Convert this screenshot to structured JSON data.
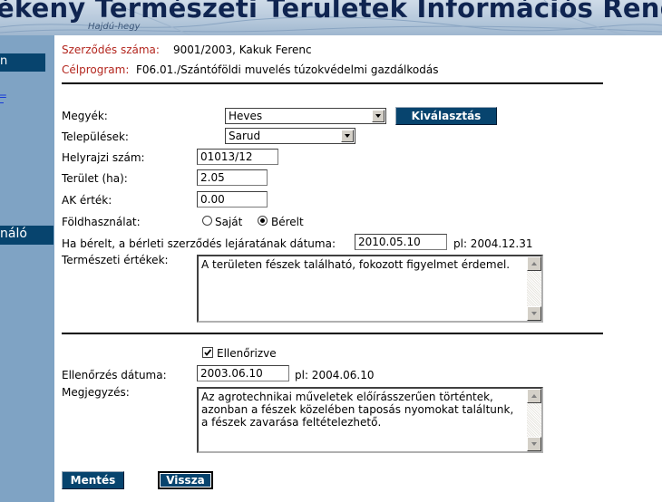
{
  "banner": {
    "title": "ékeny Természeti Területek Információs Rendszere",
    "subtitle": "Hajdú-hegy"
  },
  "sidebar": {
    "button1_label": "n",
    "link_label": "=",
    "button2_label": "náló"
  },
  "contract": {
    "number_label": "Szerződés száma:",
    "number_value": "9001/2003, Kakuk Ferenc",
    "program_label": "Célprogram:",
    "program_value": "F06.01./Szántóföldi muvelés túzokvédelmi gazdálkodás"
  },
  "form": {
    "county_label": "Megyék:",
    "county_value": "Heves",
    "select_button": "Kiválasztás",
    "settlement_label": "Települések:",
    "settlement_value": "Sarud",
    "parcel_label": "Helyrajzi szám:",
    "parcel_value": "01013/12",
    "area_label": "Terület (ha):",
    "area_value": "2.05",
    "ak_label": "AK érték:",
    "ak_value": "0.00",
    "landuse_label": "Földhasználat:",
    "landuse_options": [
      "Saját",
      "Bérelt"
    ],
    "landuse_selected": "Bérelt",
    "lease_label": "Ha bérelt, a bérleti szerződés lejáratának dátuma:",
    "lease_value": "2010.05.10",
    "lease_example": "pl: 2004.12.31",
    "natural_label": "Természeti értékek:",
    "natural_value": "A területen fészek található, fokozott figyelmet érdemel."
  },
  "control": {
    "checked_label": "Ellenőrizve",
    "checked": true,
    "date_label": "Ellenőrzés dátuma:",
    "date_value": "2003.06.10",
    "date_example": "pl: 2004.06.10",
    "note_label": "Megjegyzés:",
    "note_value": "Az agrotechnikai műveletek előírásszerűen történtek, azonban a fészek közelében taposás nyomokat találtunk, a fészek zavarása feltételezhető."
  },
  "buttons": {
    "save": "Mentés",
    "back": "Vissza"
  }
}
